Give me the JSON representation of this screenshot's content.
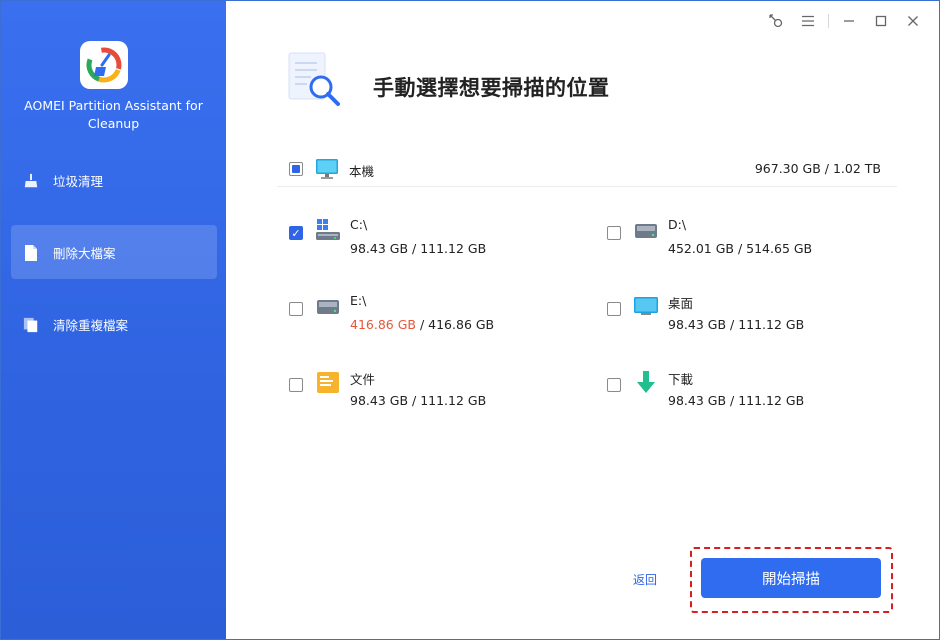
{
  "app": {
    "title": "AOMEI Partition Assistant for Cleanup"
  },
  "sidebar": {
    "items": [
      {
        "label": "垃圾清理",
        "icon": "broom-icon",
        "active": false
      },
      {
        "label": "刪除大檔案",
        "icon": "file-icon",
        "active": true
      },
      {
        "label": "清除重複檔案",
        "icon": "duplicate-files-icon",
        "active": false
      }
    ]
  },
  "window_controls": [
    "key-icon",
    "menu-icon",
    "minimize-icon",
    "maximize-icon",
    "close-icon"
  ],
  "header": {
    "title": "手動選擇想要掃描的位置",
    "icon": "document-search-icon"
  },
  "pc": {
    "name": "本機",
    "size": "967.30 GB / 1.02 TB",
    "check_state": "partial",
    "icon": "monitor-icon"
  },
  "drives": [
    {
      "name": "C:\\",
      "used": "98.43 GB",
      "total": "111.12 GB",
      "checked": true,
      "icon": "system-drive-icon",
      "warn": false
    },
    {
      "name": "D:\\",
      "used": "452.01 GB",
      "total": "514.65 GB",
      "checked": false,
      "icon": "drive-icon",
      "warn": false
    },
    {
      "name": "E:\\",
      "used": "416.86 GB",
      "total": "416.86 GB",
      "checked": false,
      "icon": "drive-icon",
      "warn": true
    },
    {
      "name": "桌面",
      "used": "98.43 GB",
      "total": "111.12 GB",
      "checked": false,
      "icon": "desktop-icon",
      "warn": false
    },
    {
      "name": "文件",
      "used": "98.43 GB",
      "total": "111.12 GB",
      "checked": false,
      "icon": "documents-folder-icon",
      "warn": false
    },
    {
      "name": "下載",
      "used": "98.43 GB",
      "total": "111.12 GB",
      "checked": false,
      "icon": "download-icon",
      "warn": false
    }
  ],
  "footer": {
    "back_label": "返回",
    "start_label": "開始掃描"
  },
  "colors": {
    "sidebar": "#2f63e0",
    "accent": "#2f6cf0",
    "warning": "#e8563a",
    "highlight": "#d81e1e"
  }
}
